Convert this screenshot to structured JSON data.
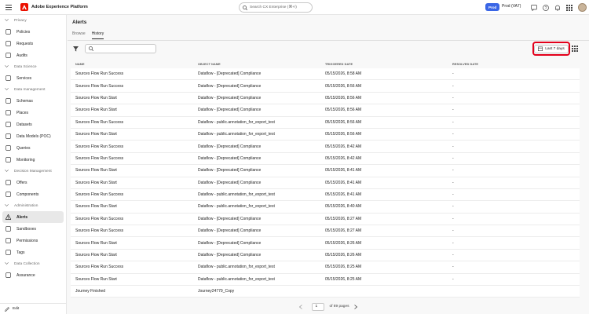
{
  "header": {
    "app_title": "Adobe Experience Platform",
    "search_placeholder": "Search CX Enterprise (⌘+/)",
    "sandbox_badge": "Prod",
    "sandbox_name": "Prod (VA7)"
  },
  "sidebar": {
    "sections": [
      {
        "label": "Privacy",
        "items": [
          {
            "label": "Policies",
            "icon": "policies-icon"
          },
          {
            "label": "Requests",
            "icon": "requests-icon"
          },
          {
            "label": "Audits",
            "icon": "audits-icon"
          }
        ]
      },
      {
        "label": "Data Science",
        "items": [
          {
            "label": "Services",
            "icon": "services-icon"
          }
        ]
      },
      {
        "label": "Data management",
        "items": [
          {
            "label": "Schemas",
            "icon": "schemas-icon"
          },
          {
            "label": "Places",
            "icon": "places-icon"
          },
          {
            "label": "Datasets",
            "icon": "datasets-icon"
          },
          {
            "label": "Data Models (POC)",
            "icon": "data-models-icon"
          },
          {
            "label": "Queries",
            "icon": "queries-icon"
          },
          {
            "label": "Monitoring",
            "icon": "monitoring-icon"
          }
        ]
      },
      {
        "label": "Decision Management",
        "items": [
          {
            "label": "Offers",
            "icon": "offers-icon"
          },
          {
            "label": "Components",
            "icon": "components-icon"
          }
        ]
      },
      {
        "label": "Administration",
        "items": [
          {
            "label": "Alerts",
            "icon": "alerts-icon"
          },
          {
            "label": "Sandboxes",
            "icon": "sandboxes-icon"
          },
          {
            "label": "Permissions",
            "icon": "permissions-icon"
          },
          {
            "label": "Tags",
            "icon": "tags-icon"
          }
        ]
      },
      {
        "label": "Data Collection",
        "items": [
          {
            "label": "Assurance",
            "icon": "assurance-icon"
          }
        ]
      }
    ],
    "edit_label": "Edit"
  },
  "page": {
    "title": "Alerts",
    "tabs": [
      "Browse",
      "History"
    ],
    "active_tab": "History",
    "date_filter": "Last 7 days",
    "columns": [
      "NAME",
      "OBJECT NAME",
      "TRIGGERED DATE",
      "RESOLVED DATE"
    ],
    "rows": [
      [
        "Sources Flow Run Success",
        "Dataflow - [Deprecated] Compliance",
        "05/15/2026, 8:58 AM",
        "-"
      ],
      [
        "Sources Flow Run Success",
        "Dataflow - [Deprecated] Compliance",
        "05/15/2026, 8:56 AM",
        "-"
      ],
      [
        "Sources Flow Run Start",
        "Dataflow - [Deprecated] Compliance",
        "05/15/2026, 8:56 AM",
        "-"
      ],
      [
        "Sources Flow Run Start",
        "Dataflow - [Deprecated] Compliance",
        "05/15/2026, 8:56 AM",
        "-"
      ],
      [
        "Sources Flow Run Success",
        "Dataflow - public.annotation_for_export_test",
        "05/15/2026, 8:56 AM",
        "-"
      ],
      [
        "Sources Flow Run Start",
        "Dataflow - public.annotation_for_export_test",
        "05/15/2026, 8:56 AM",
        "-"
      ],
      [
        "Sources Flow Run Success",
        "Dataflow - [Deprecated] Compliance",
        "05/15/2026, 8:42 AM",
        "-"
      ],
      [
        "Sources Flow Run Success",
        "Dataflow - [Deprecated] Compliance",
        "05/15/2026, 8:42 AM",
        "-"
      ],
      [
        "Sources Flow Run Start",
        "Dataflow - [Deprecated] Compliance",
        "05/15/2026, 8:41 AM",
        "-"
      ],
      [
        "Sources Flow Run Start",
        "Dataflow - [Deprecated] Compliance",
        "05/15/2026, 8:41 AM",
        "-"
      ],
      [
        "Sources Flow Run Success",
        "Dataflow - public.annotation_for_export_test",
        "05/15/2026, 8:41 AM",
        "-"
      ],
      [
        "Sources Flow Run Start",
        "Dataflow - public.annotation_for_export_test",
        "05/15/2026, 8:40 AM",
        "-"
      ],
      [
        "Sources Flow Run Success",
        "Dataflow - [Deprecated] Compliance",
        "05/15/2026, 8:27 AM",
        "-"
      ],
      [
        "Sources Flow Run Success",
        "Dataflow - [Deprecated] Compliance",
        "05/15/2026, 8:27 AM",
        "-"
      ],
      [
        "Sources Flow Run Start",
        "Dataflow - [Deprecated] Compliance",
        "05/15/2026, 8:26 AM",
        "-"
      ],
      [
        "Sources Flow Run Start",
        "Dataflow - [Deprecated] Compliance",
        "05/15/2026, 8:26 AM",
        "-"
      ],
      [
        "Sources Flow Run Success",
        "Dataflow - public.annotation_for_export_test",
        "05/15/2026, 8:25 AM",
        "-"
      ],
      [
        "Sources Flow Run Start",
        "Dataflow - public.annotation_for_export_test",
        "05/15/2026, 8:25 AM",
        "-"
      ],
      [
        "Journey Finished",
        "Journey24779_Copy",
        "",
        ""
      ]
    ],
    "pagination": {
      "current_page": "1",
      "total_label": "of 89 pages"
    }
  },
  "colors": {
    "accent": "#3a66e6",
    "highlight_border": "#e3001b",
    "brand": "#eb1000"
  }
}
